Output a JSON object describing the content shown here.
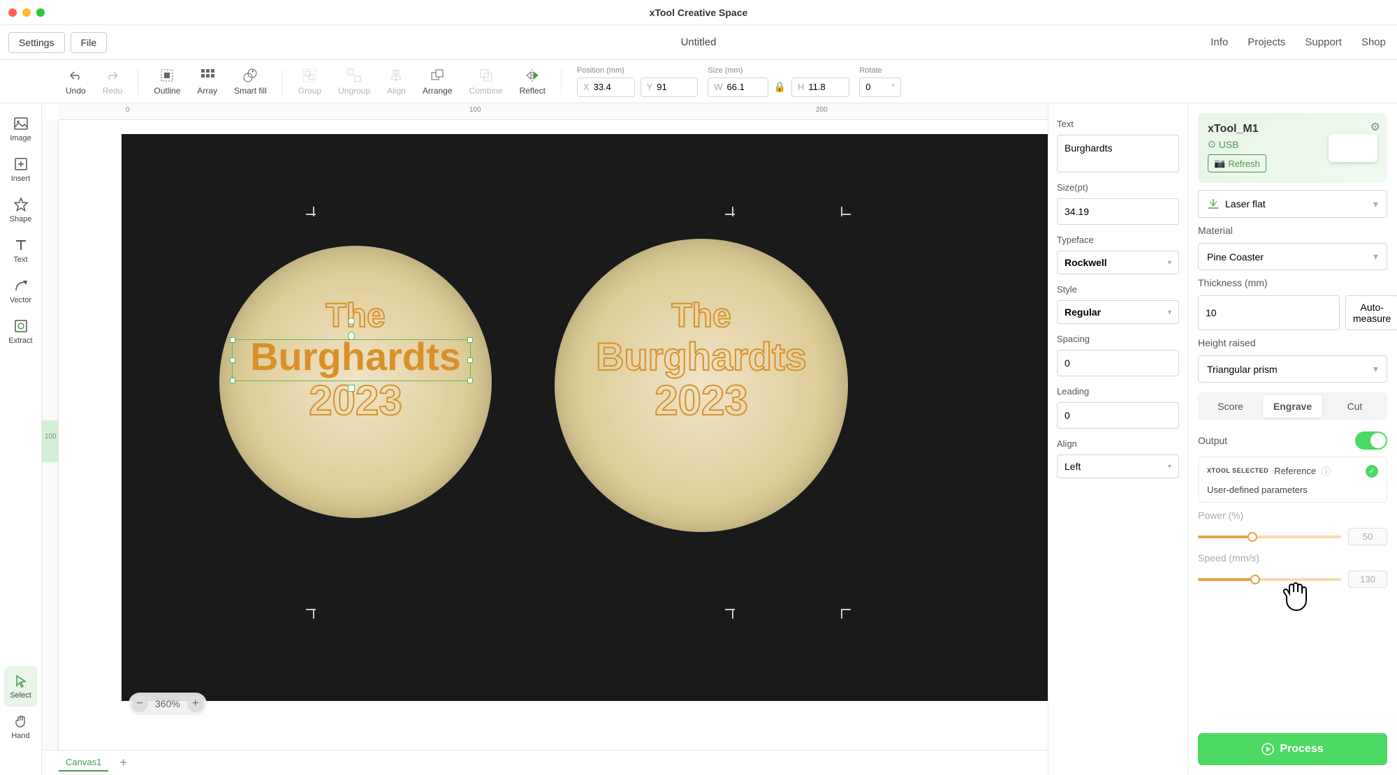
{
  "titlebar": {
    "title": "xTool Creative Space"
  },
  "menubar": {
    "settings": "Settings",
    "file": "File",
    "doc_title": "Untitled",
    "right": {
      "info": "Info",
      "projects": "Projects",
      "support": "Support",
      "shop": "Shop"
    }
  },
  "toolbar": {
    "undo": "Undo",
    "redo": "Redo",
    "outline": "Outline",
    "array": "Array",
    "smartfill": "Smart fill",
    "group": "Group",
    "ungroup": "Ungroup",
    "align": "Align",
    "arrange": "Arrange",
    "combine": "Combine",
    "reflect": "Reflect",
    "position_label": "Position (mm)",
    "x_prefix": "X",
    "x_val": "33.4",
    "y_prefix": "Y",
    "y_val": "91",
    "size_label": "Size (mm)",
    "w_prefix": "W",
    "w_val": "66.1",
    "h_prefix": "H",
    "h_val": "11.8",
    "rotate_label": "Rotate",
    "rotate_val": "0",
    "rotate_unit": "°"
  },
  "left_rail": {
    "image": "Image",
    "insert": "Insert",
    "shape": "Shape",
    "text": "Text",
    "vector": "Vector",
    "extract": "Extract",
    "select": "Select",
    "hand": "Hand"
  },
  "canvas": {
    "ruler_h": [
      "0",
      "100",
      "200"
    ],
    "ruler_v_active": "100",
    "zoom": "360%",
    "tab1": "Canvas1",
    "text_on_wood": {
      "line1": "The",
      "line2": "Burghardts",
      "line3": "2023"
    }
  },
  "text_panel": {
    "text_label": "Text",
    "text_value": "Burghardts",
    "size_label": "Size(pt)",
    "size_value": "34.19",
    "typeface_label": "Typeface",
    "typeface_value": "Rockwell",
    "style_label": "Style",
    "style_value": "Regular",
    "spacing_label": "Spacing",
    "spacing_value": "0",
    "leading_label": "Leading",
    "leading_value": "0",
    "align_label": "Align",
    "align_value": "Left"
  },
  "device_panel": {
    "device_name": "xTool_M1",
    "connection": "USB",
    "refresh": "Refresh",
    "mode_value": "Laser flat",
    "material_label": "Material",
    "material_value": "Pine Coaster",
    "thickness_label": "Thickness (mm)",
    "thickness_value": "10",
    "auto_measure": "Auto-measure",
    "height_label": "Height raised",
    "height_value": "Triangular prism",
    "tabs": {
      "score": "Score",
      "engrave": "Engrave",
      "cut": "Cut"
    },
    "output_label": "Output",
    "reference_badge": "XTOOL SELECTED",
    "reference_label": "Reference",
    "user_params": "User-defined parameters",
    "power_label": "Power (%)",
    "power_value": "50",
    "speed_label": "Speed (mm/s)",
    "speed_value": "130",
    "process": "Process"
  }
}
